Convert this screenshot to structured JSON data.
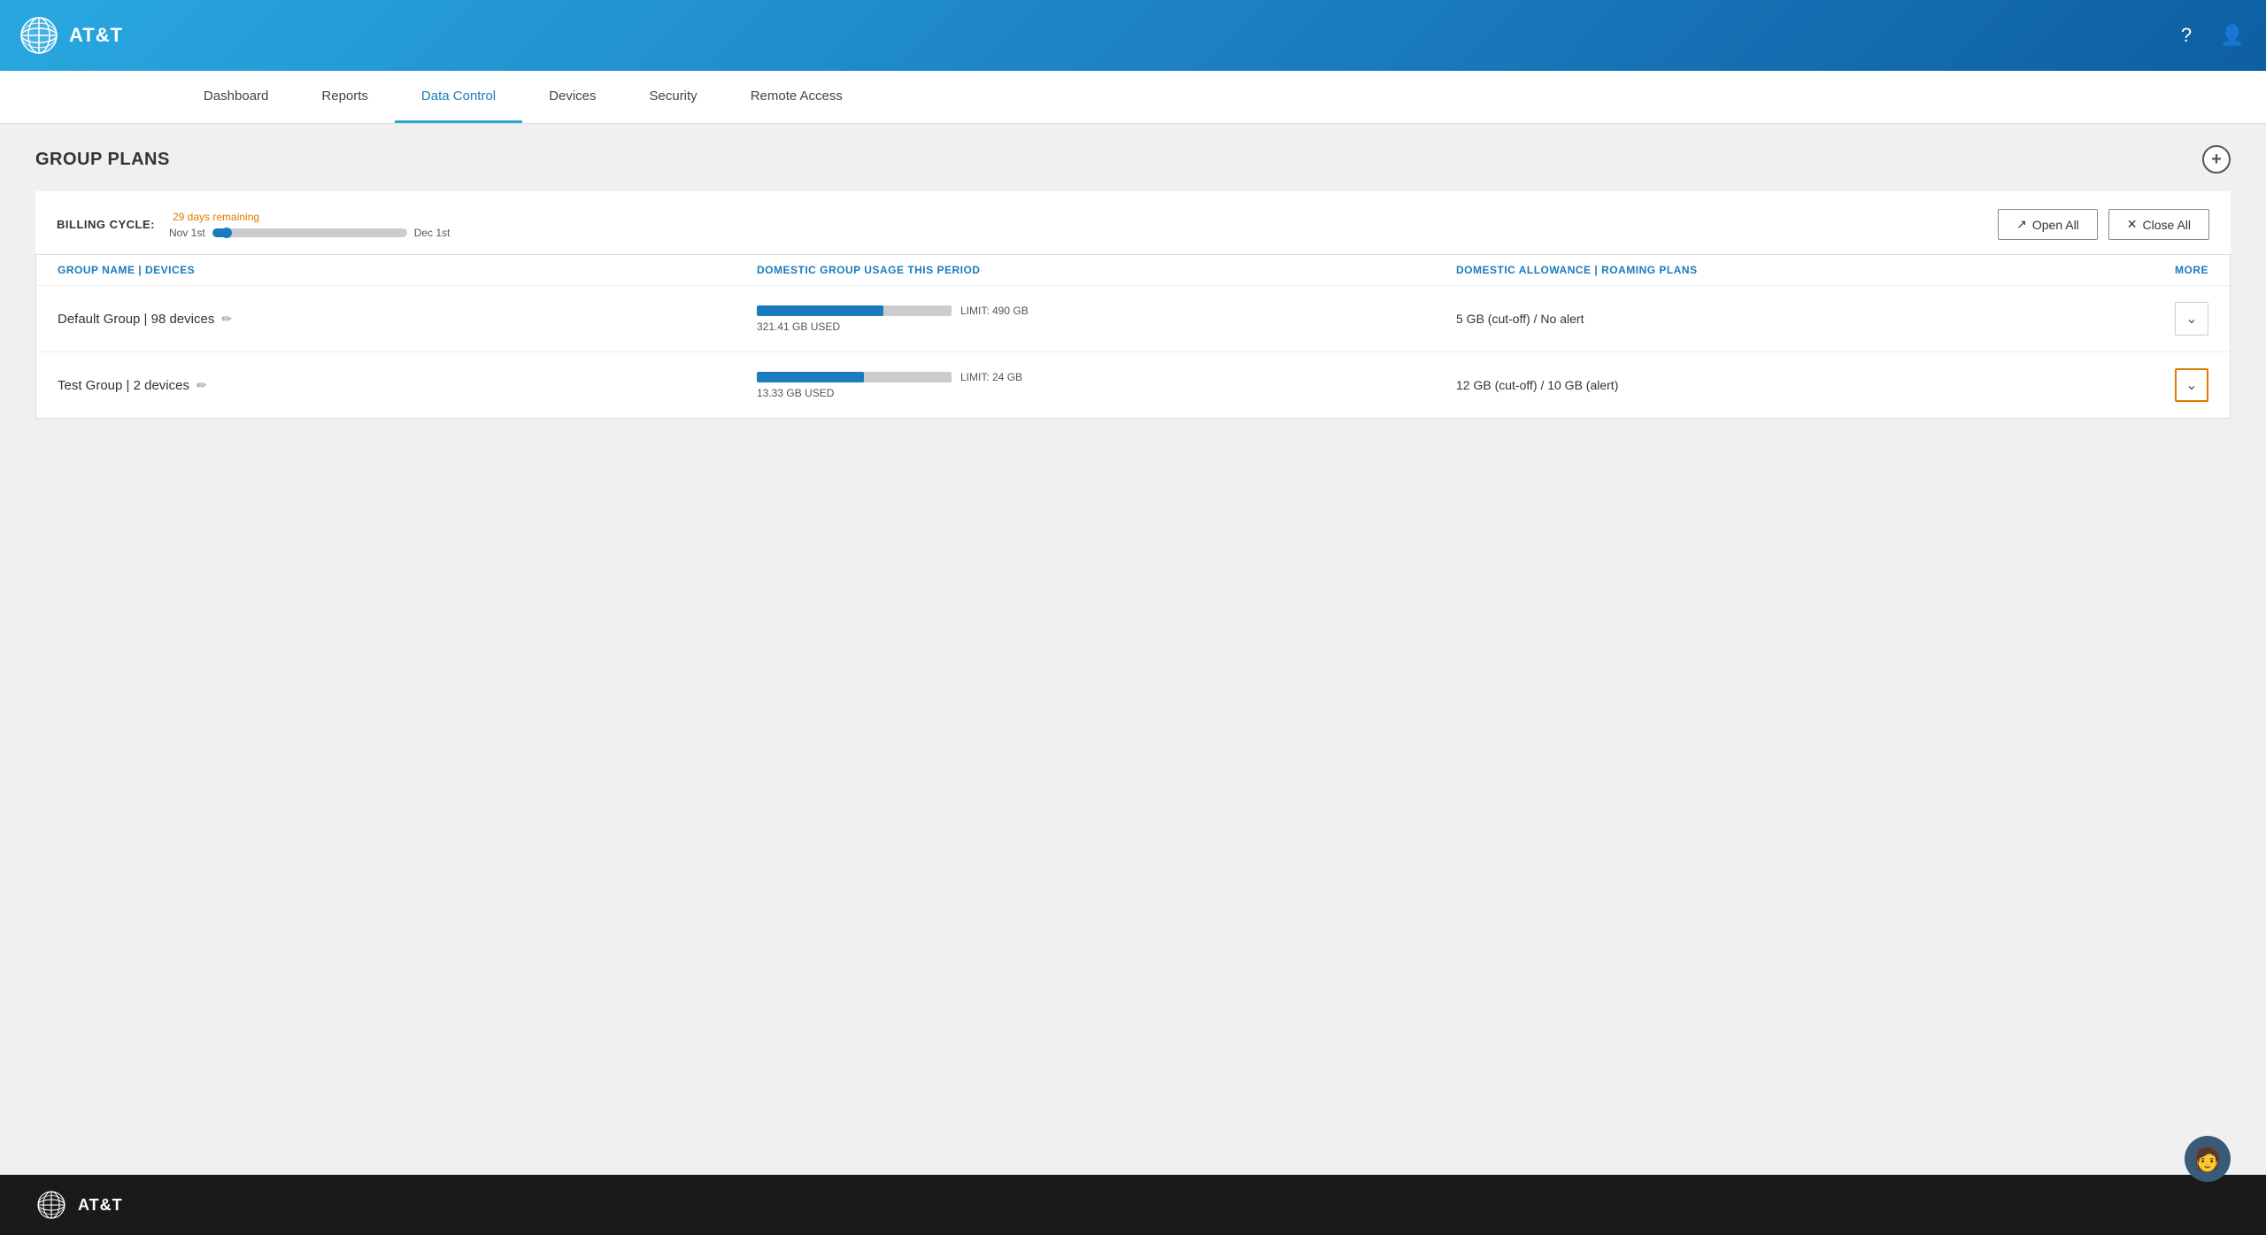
{
  "header": {
    "logo_text": "AT&T",
    "help_icon": "?",
    "user_icon": "👤"
  },
  "nav": {
    "items": [
      {
        "id": "dashboard",
        "label": "Dashboard",
        "active": false
      },
      {
        "id": "reports",
        "label": "Reports",
        "active": false
      },
      {
        "id": "data-control",
        "label": "Data Control",
        "active": true
      },
      {
        "id": "devices",
        "label": "Devices",
        "active": false
      },
      {
        "id": "security",
        "label": "Security",
        "active": false
      },
      {
        "id": "remote-access",
        "label": "Remote Access",
        "active": false
      }
    ]
  },
  "section": {
    "title": "GROUP PLANS"
  },
  "billing": {
    "label": "BILLING CYCLE:",
    "days_remaining": "29 days remaining",
    "start_date": "Nov 1st",
    "end_date": "Dec 1st",
    "progress_percent": 8,
    "open_all_label": "Open All",
    "close_all_label": "Close All"
  },
  "table": {
    "columns": [
      {
        "id": "group-name",
        "label": "GROUP NAME | DEVICES"
      },
      {
        "id": "usage",
        "label": "DOMESTIC GROUP USAGE THIS PERIOD"
      },
      {
        "id": "allowance",
        "label": "DOMESTIC ALLOWANCE | ROAMING PLANS"
      },
      {
        "id": "more",
        "label": "MORE"
      }
    ],
    "rows": [
      {
        "id": "default-group",
        "name": "Default Group | 98 devices",
        "usage_used": "321.41 GB USED",
        "usage_limit": "LIMIT: 490 GB",
        "usage_percent": 65,
        "allowance": "5 GB (cut-off) / No alert",
        "expanded": false,
        "highlighted": false
      },
      {
        "id": "test-group",
        "name": "Test Group | 2 devices",
        "usage_used": "13.33 GB USED",
        "usage_limit": "LIMIT: 24 GB",
        "usage_percent": 55,
        "allowance": "12 GB (cut-off) / 10 GB (alert)",
        "expanded": false,
        "highlighted": true
      }
    ]
  },
  "footer": {
    "logo_text": "AT&T"
  },
  "chat_btn": "🧑"
}
